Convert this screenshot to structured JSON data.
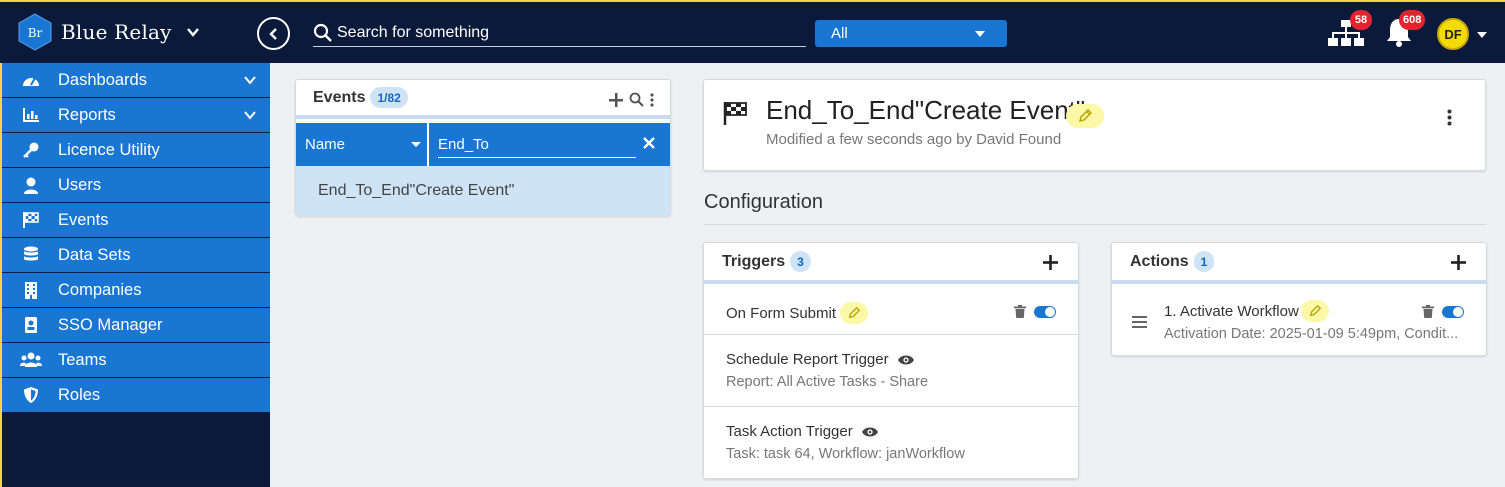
{
  "brand": {
    "logo_text": "Br",
    "name": "Blue Relay"
  },
  "search": {
    "placeholder": "Search for something",
    "scope": "All"
  },
  "notifications": {
    "network_count": "58",
    "alert_count": "608"
  },
  "user": {
    "initials": "DF"
  },
  "sidebar": {
    "items": [
      {
        "label": "Dashboards",
        "icon": "gauge-icon",
        "expandable": true
      },
      {
        "label": "Reports",
        "icon": "bar-chart-icon",
        "expandable": true
      },
      {
        "label": "Licence Utility",
        "icon": "key-icon",
        "expandable": false
      },
      {
        "label": "Users",
        "icon": "user-icon",
        "expandable": false
      },
      {
        "label": "Events",
        "icon": "checkered-flag-icon",
        "expandable": false
      },
      {
        "label": "Data Sets",
        "icon": "database-icon",
        "expandable": false
      },
      {
        "label": "Companies",
        "icon": "building-icon",
        "expandable": false
      },
      {
        "label": "SSO Manager",
        "icon": "id-badge-icon",
        "expandable": false
      },
      {
        "label": "Teams",
        "icon": "users-icon",
        "expandable": false
      },
      {
        "label": "Roles",
        "icon": "shield-icon",
        "expandable": false
      }
    ]
  },
  "events_panel": {
    "title": "Events",
    "count": "1/82",
    "filter_field": "Name",
    "filter_value": "End_To",
    "results": [
      "End_To_End\"Create Event\""
    ]
  },
  "event_detail": {
    "title": "End_To_End\"Create Event\"",
    "modified": "Modified a few seconds ago by David Found"
  },
  "configuration": {
    "title": "Configuration",
    "triggers": {
      "title": "Triggers",
      "count": "3",
      "items": [
        {
          "name": "On Form Submit",
          "subtitle": ""
        },
        {
          "name": "Schedule Report Trigger",
          "subtitle": "Report: All Active Tasks - Share"
        },
        {
          "name": "Task Action Trigger",
          "subtitle": "Task: task 64, Workflow: janWorkflow"
        }
      ]
    },
    "actions": {
      "title": "Actions",
      "count": "1",
      "items": [
        {
          "name": "1. Activate Workflow",
          "subtitle": "Activation Date: 2025-01-09 5:49pm, Condit..."
        }
      ]
    }
  },
  "colors": {
    "topbar": "#0b1a3a",
    "accent": "#1976d2",
    "highlight": "#fbf8a8",
    "badge": "#e3232d"
  }
}
